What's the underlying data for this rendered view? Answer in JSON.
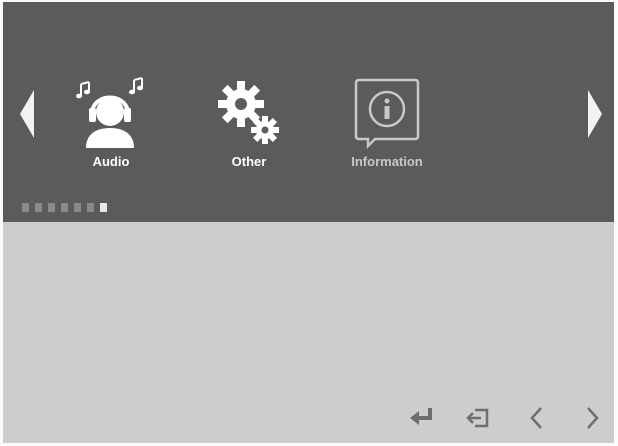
{
  "menu": {
    "items": [
      {
        "label": "Audio",
        "icon": "headphones-person-icon"
      },
      {
        "label": "Other",
        "icon": "gears-icon"
      },
      {
        "label": "Information",
        "icon": "info-icon"
      }
    ],
    "nav": {
      "prev_icon": "left-arrow-icon",
      "next_icon": "right-arrow-icon"
    },
    "pages": {
      "count": 7,
      "active_index": 6
    }
  },
  "footer": {
    "hints": [
      {
        "icon": "enter-icon"
      },
      {
        "icon": "exit-icon"
      },
      {
        "icon": "chevron-left-icon"
      },
      {
        "icon": "chevron-right-icon"
      }
    ]
  },
  "colors": {
    "menu_background": "#5b5b5b",
    "content_background": "#cdcdcd",
    "icon_color": "#ffffff",
    "hint_color": "#6e6e6e"
  }
}
